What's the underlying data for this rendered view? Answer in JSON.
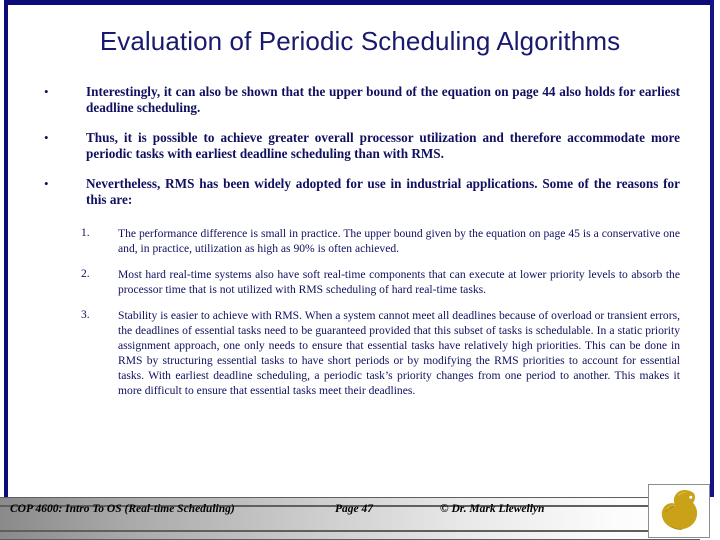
{
  "slide": {
    "title": "Evaluation of Periodic Scheduling Algorithms",
    "title_color": "#19196e",
    "body_color": "#101060",
    "border_color": "#0c0c78",
    "accent_color": "#c8a417"
  },
  "bullets": [
    {
      "mark": "•",
      "text": "Interestingly, it can also be shown that the upper bound of the equation on page 44 also holds for earliest deadline scheduling."
    },
    {
      "mark": "•",
      "text": "Thus, it is possible to achieve greater overall processor utilization and therefore accommodate more periodic tasks with earliest deadline scheduling than with RMS."
    },
    {
      "mark": "•",
      "text": "Nevertheless, RMS has been widely adopted for use in industrial applications. Some of the reasons for this are:"
    }
  ],
  "numbered": [
    {
      "mark": "1.",
      "text": "The performance difference is small in practice.  The upper bound given by the equation on page 45 is a conservative one and, in practice, utilization as high as 90% is often achieved."
    },
    {
      "mark": "2.",
      "text": "Most hard real-time systems also have soft real-time components that can execute at lower priority levels to absorb the processor time that is not utilized with RMS scheduling of hard real-time tasks."
    },
    {
      "mark": "3.",
      "text": "Stability is easier to achieve with RMS.  When a system cannot meet all deadlines because of overload or transient errors, the deadlines of essential tasks need to be guaranteed provided that this subset of tasks is schedulable.  In a static priority assignment approach, one only needs to ensure that essential tasks have relatively high priorities.  This can be done in RMS by structuring essential tasks to have short periods or by modifying the RMS priorities to account for essential tasks.  With earliest deadline scheduling, a periodic task’s priority changes from one period to another.  This makes it more difficult to ensure that essential tasks meet their deadlines."
    }
  ],
  "footer": {
    "course": "COP 4600: Intro To OS  (Real-time Scheduling)",
    "page": "Page 47",
    "author": "© Dr. Mark Llewellyn",
    "logo_name": "ucf-pegasus-logo"
  }
}
